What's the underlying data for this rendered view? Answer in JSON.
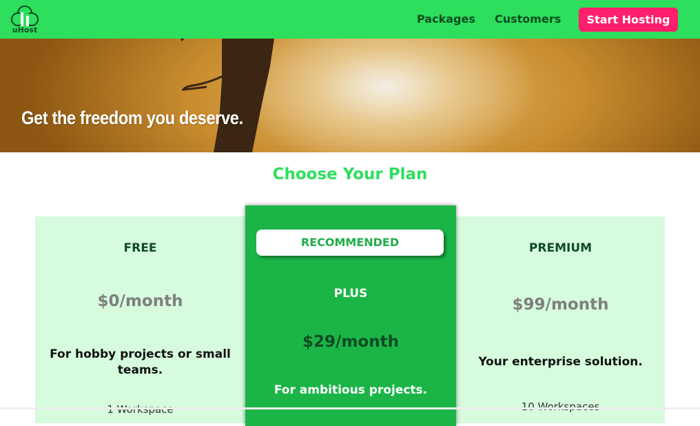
{
  "header": {
    "logo_text": "uHost",
    "nav": {
      "packages": "Packages",
      "customers": "Customers",
      "cta": "Start Hosting"
    }
  },
  "hero": {
    "tagline": "Get the freedom you deserve."
  },
  "plans_section": {
    "title": "Choose Your Plan",
    "plans": [
      {
        "name": "FREE",
        "price": "$0/month",
        "description": "For hobby projects or small teams.",
        "feature": "1 Workspace"
      },
      {
        "badge": "RECOMMENDED",
        "name": "PLUS",
        "price": "$29/month",
        "description": "For ambitious projects."
      },
      {
        "name": "PREMIUM",
        "price": "$99/month",
        "description": "Your enterprise solution.",
        "feature": "10 Workspaces"
      }
    ]
  },
  "colors": {
    "nav_bg": "#2ddf5c",
    "cta_bg": "#ff1f6d",
    "card_bg": "#d6fbdd",
    "plus_bg": "#1bb547",
    "title": "#2ddf5c"
  }
}
